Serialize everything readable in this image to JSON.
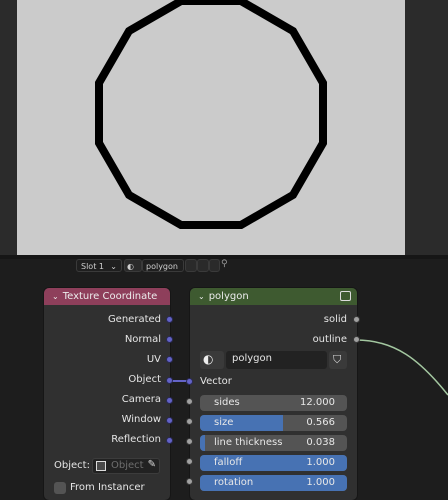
{
  "header": {
    "slot_label": "Slot 1",
    "material_name": "polygon"
  },
  "preview": {
    "shape": "dodecagon",
    "stroke_color": "#000000",
    "background": "#cbcbcb"
  },
  "texcoord_node": {
    "title": "Texture Coordinate",
    "header_color": "#8e3f5b",
    "outputs": [
      "Generated",
      "Normal",
      "UV",
      "Object",
      "Camera",
      "Window",
      "Reflection"
    ],
    "object_label": "Object:",
    "object_placeholder": "Object",
    "from_instancer_label": "From Instancer",
    "from_instancer_checked": false
  },
  "polygon_node": {
    "title": "polygon",
    "header_color": "#3e5a30",
    "outputs": [
      "solid",
      "outline"
    ],
    "group_name": "polygon",
    "vector_label": "Vector",
    "params": [
      {
        "label": "sides",
        "value": "12.000",
        "fill": 0.0
      },
      {
        "label": "size",
        "value": "0.566",
        "fill": 0.566
      },
      {
        "label": "line thickness",
        "value": "0.038",
        "fill": 0.038
      },
      {
        "label": "falloff",
        "value": "1.000",
        "fill": 1.0
      },
      {
        "label": "rotation",
        "value": "1.000",
        "fill": 1.0
      }
    ]
  },
  "colors": {
    "vector_socket": "#6363c7",
    "float_socket": "#a1a1a1",
    "slider_fill": "#4772b3"
  }
}
